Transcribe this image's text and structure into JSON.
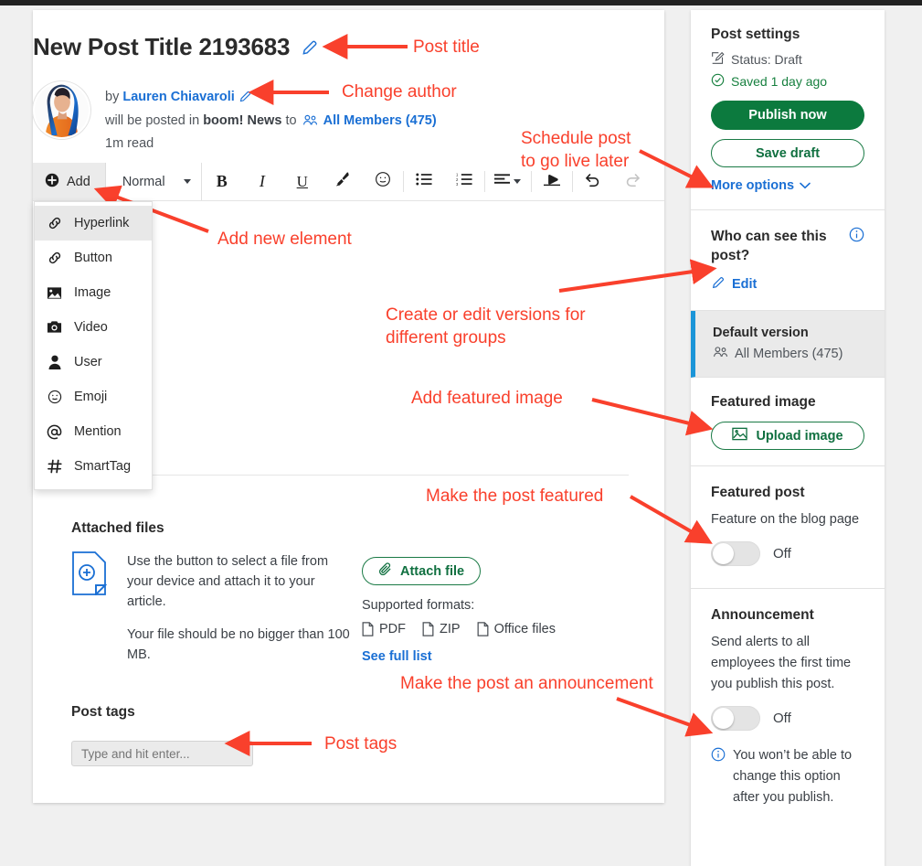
{
  "post": {
    "title": "New Post Title 2193683",
    "author_prefix": "by",
    "author_name": "Lauren Chiavaroli",
    "posted_in_prefix": "will be posted in",
    "channel": "boom! News",
    "posted_to": "to",
    "audience": "All Members (475)",
    "read_time": "1m read"
  },
  "toolbar": {
    "add_label": "Add",
    "format_label": "Normal",
    "bold": "B",
    "italic": "I",
    "underline": "U",
    "brush": "brush-icon",
    "emoji": "emoji-icon",
    "bullet_list": "bullet-list-icon",
    "numbered_list": "numbered-list-icon",
    "align": "align-left-icon",
    "clear_format": "eraser-icon",
    "undo": "undo-icon",
    "redo": "redo-icon"
  },
  "add_menu": {
    "items": [
      {
        "label": "Hyperlink",
        "icon": "link-icon",
        "selected": true
      },
      {
        "label": "Button",
        "icon": "link-icon",
        "selected": false
      },
      {
        "label": "Image",
        "icon": "image-icon",
        "selected": false
      },
      {
        "label": "Video",
        "icon": "camera-icon",
        "selected": false
      },
      {
        "label": "User",
        "icon": "user-icon",
        "selected": false
      },
      {
        "label": "Emoji",
        "icon": "emoji-icon",
        "selected": false
      },
      {
        "label": "Mention",
        "icon": "at-icon",
        "selected": false
      },
      {
        "label": "SmartTag",
        "icon": "hash-icon",
        "selected": false
      }
    ]
  },
  "attached_files": {
    "heading": "Attached files",
    "desc1": "Use the button to select a file from your device and attach it to your article.",
    "desc2": "Your file should be no bigger than 100 MB.",
    "attach_button": "Attach file",
    "supported_label": "Supported formats:",
    "formats": [
      "PDF",
      "ZIP",
      "Office files"
    ],
    "see_full_list": "See full list"
  },
  "post_tags": {
    "heading": "Post tags",
    "placeholder": "Type and hit enter..."
  },
  "sidebar": {
    "settings": {
      "title": "Post settings",
      "status": "Status: Draft",
      "saved": "Saved 1 day ago",
      "publish_button": "Publish now",
      "draft_button": "Save draft",
      "more_options": "More options"
    },
    "visibility": {
      "title": "Who can see this post?",
      "edit": "Edit",
      "version_name": "Default version",
      "version_audience": "All Members (475)"
    },
    "featured_image": {
      "title": "Featured image",
      "upload_button": "Upload image"
    },
    "featured_post": {
      "title": "Featured post",
      "desc": "Feature on the blog page",
      "toggle_state": "Off"
    },
    "announcement": {
      "title": "Announcement",
      "desc": "Send alerts to all employees the first time you publish this post.",
      "toggle_state": "Off",
      "note": "You won’t be able to change this option after you publish."
    }
  },
  "annotations": {
    "post_title": "Post title",
    "change_author": "Change author",
    "schedule_post": "Schedule post\nto go live later",
    "add_new_element": "Add new element",
    "versions": "Create or edit versions for\ndifferent groups",
    "featured_image": "Add featured image",
    "make_featured": "Make the post featured",
    "make_announcement": "Make the post an announcement",
    "post_tags": "Post tags"
  },
  "colors": {
    "accent_red": "#f9402c",
    "link_blue": "#1a6fd4",
    "green": "#0c7a3e",
    "version_bar": "#1b95d8",
    "page_bg": "#f0f0f0"
  }
}
